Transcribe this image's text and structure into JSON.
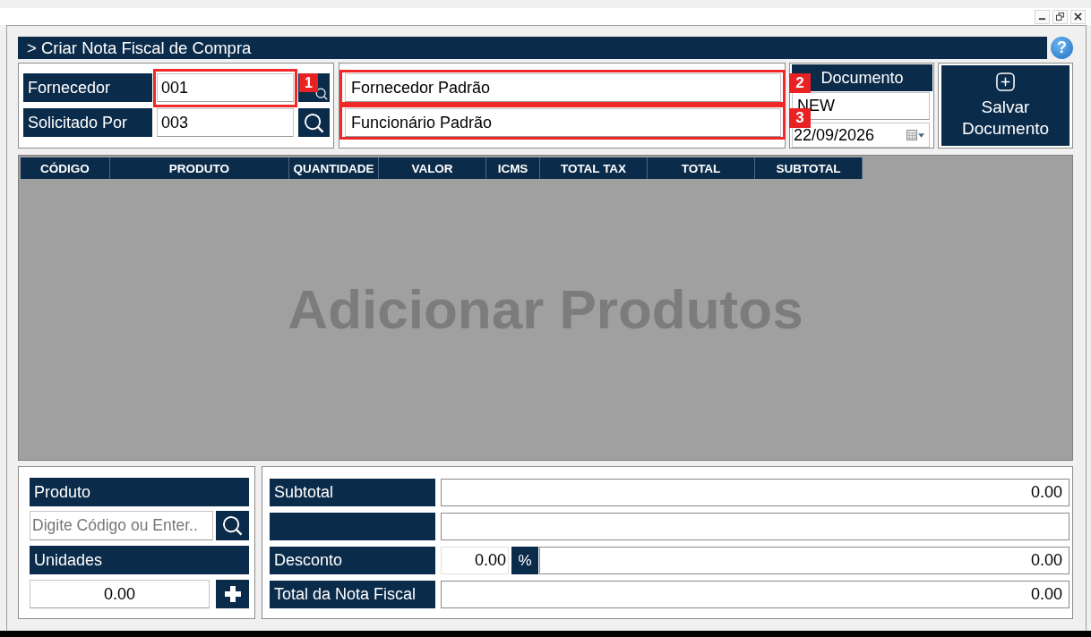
{
  "header": {
    "title": "> Criar Nota Fiscal de Compra",
    "help_symbol": "?"
  },
  "lookups": [
    {
      "label": "Fornecedor",
      "code": "001",
      "code_callout": "1",
      "name": "Fornecedor Padrão",
      "name_callout": "2"
    },
    {
      "label": "Solicitado Por",
      "code": "003",
      "name": "Funcionário Padrão",
      "name_callout": "3"
    }
  ],
  "document": {
    "title": "Documento",
    "number": "NEW",
    "date": "22/09/2026"
  },
  "save_button": {
    "label": "Salvar Documento"
  },
  "table": {
    "columns": [
      "CÓDIGO",
      "PRODUTO",
      "QUANTIDADE",
      "VALOR",
      "ICMS",
      "TOTAL TAX",
      "TOTAL",
      "SUBTOTAL"
    ],
    "empty_message": "Adicionar Produtos"
  },
  "product_entry": {
    "product_label": "Produto",
    "search_placeholder": "Digite Código ou Enter..",
    "units_label": "Unidades",
    "units_value": "0.00"
  },
  "totals": [
    {
      "kind": "amount",
      "label": "Subtotal",
      "value": "0.00"
    },
    {
      "kind": "blank"
    },
    {
      "kind": "discount",
      "label": "Desconto",
      "percent_value": "0.00",
      "percent_button": "%",
      "value": "0.00"
    },
    {
      "kind": "amount",
      "label": "Total da Nota Fiscal",
      "value": "0.00"
    }
  ]
}
